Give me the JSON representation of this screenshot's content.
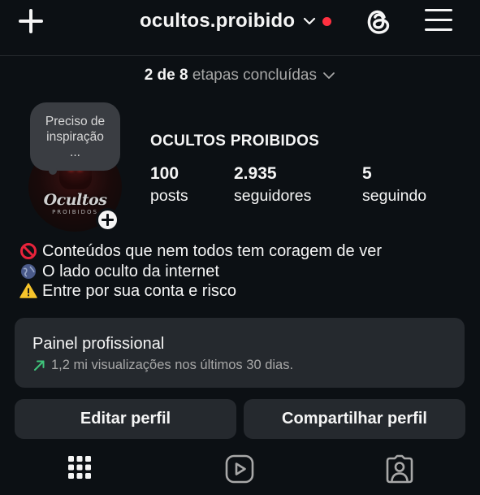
{
  "header": {
    "username": "ocultos.proibido"
  },
  "onboarding": {
    "completed": "2 de 8",
    "suffix": "etapas concluídas"
  },
  "profile": {
    "note_line1": "Preciso de",
    "note_line2": "inspiração",
    "note_line3": "...",
    "avatar_logo": "Ocultos",
    "avatar_logo_sub": "PROIBIDOS",
    "display_name": "OCULTOS PROIBIDOS",
    "stats": {
      "posts_count": "100",
      "posts_label": "posts",
      "followers_count": "2.935",
      "followers_label": "seguidores",
      "following_count": "5",
      "following_label": "seguindo"
    },
    "bio": [
      "Conteúdos que nem todos tem coragem de ver",
      "O lado oculto da internet",
      "Entre por sua conta e risco"
    ]
  },
  "dashboard": {
    "title": "Painel profissional",
    "subtitle": "1,2 mi visualizações nos últimos 30 dias."
  },
  "actions": {
    "edit_label": "Editar perfil",
    "share_label": "Compartilhar perfil"
  },
  "tabs": [
    "grid-icon",
    "reels-icon",
    "tagged-icon"
  ],
  "colors": {
    "background": "#0c1014",
    "surface": "#25292e",
    "accent_red": "#ff3040",
    "trend_green": "#3fc57b",
    "muted_text": "#a8a8a8"
  }
}
